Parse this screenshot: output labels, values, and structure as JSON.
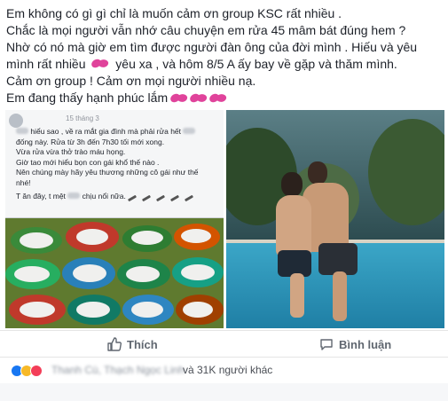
{
  "post": {
    "line1": "Em không có gì gì chỉ là muốn cảm ơn group KSC rất nhiều .",
    "line2": "Chắc là mọi người vẫn nhớ câu chuyện em rửa 45 mâm bát đúng hem ?",
    "line3": "Nhờ có nó mà giờ em tìm được người đàn ông của đời mình . Hiếu và yêu",
    "line4a": "mình rất nhiều",
    "line4b": "yêu xa , và hôm 8/5 A ấy bay về gặp và thăm mình.",
    "line5": "Cảm ơn group ! Cảm ơn mọi người nhiều nạ.",
    "line6": "Em đang thấy hạnh phúc lắm"
  },
  "embedded_post": {
    "date": "15 tháng 3",
    "line1": "hiểu sao , về ra mắt gia đình mà phải rửa hết",
    "line2": "đống này. Rửa từ 3h đến 7h30 tối mới xong.",
    "line3": "Vừa rửa vừa thở trào máu họng.",
    "line4": "Giờ tao mới hiểu bọn con gái khổ thế nào .",
    "line5": "Nên chúng mày hãy yêu thương những cô gái như thế",
    "line6": "nhé!",
    "line7a": "T ăn đây, t mệt",
    "line7b": "chịu nổi nữa."
  },
  "actions": {
    "like_label": "Thích",
    "comment_label": "Bình luận"
  },
  "reactions": {
    "names": "Thanh Cù, Thạch Ngọc Linh",
    "count_label": "và 31K người khác",
    "icons": [
      "like-icon",
      "haha-icon",
      "love-icon"
    ]
  },
  "colors": {
    "text": "#1d2129",
    "action_gray": "#606770",
    "lips": "#e0439b"
  }
}
